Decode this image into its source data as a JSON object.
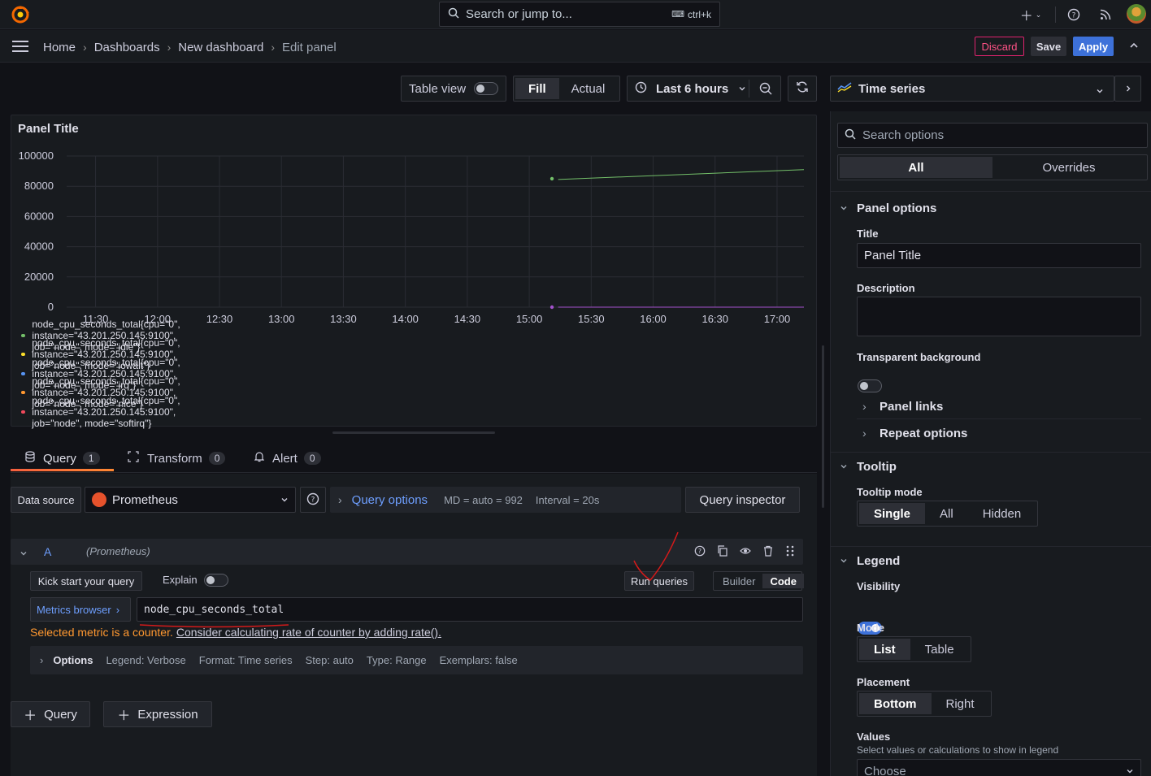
{
  "topbar": {
    "search_placeholder": "Search or jump to...",
    "search_shortcut": "ctrl+k",
    "icons": [
      "grafana-logo-icon",
      "plus-icon",
      "help-icon",
      "rss-icon",
      "user-avatar"
    ]
  },
  "breadcrumb": {
    "items": [
      "Home",
      "Dashboards",
      "New dashboard",
      "Edit panel"
    ]
  },
  "actions": {
    "discard": "Discard",
    "save": "Save",
    "apply": "Apply"
  },
  "toolbar": {
    "table_view": "Table view",
    "fill": "Fill",
    "actual": "Actual",
    "time_range": "Last 6 hours",
    "visualization": "Time series"
  },
  "panel": {
    "title": "Panel Title",
    "legend": [
      {
        "label": "node_cpu_seconds_total{cpu=\"0\", instance=\"43.201.250.145:9100\", job=\"node\", mode=\"idle\"}",
        "color": "#73bf69"
      },
      {
        "label": "node_cpu_seconds_total{cpu=\"0\", instance=\"43.201.250.145:9100\", job=\"node\", mode=\"iowait\"}",
        "color": "#fade2a"
      },
      {
        "label": "node_cpu_seconds_total{cpu=\"0\", instance=\"43.201.250.145:9100\", job=\"node\", mode=\"irq\"}",
        "color": "#5794f2"
      },
      {
        "label": "node_cpu_seconds_total{cpu=\"0\", instance=\"43.201.250.145:9100\", job=\"node\", mode=\"nice\"}",
        "color": "#ff9830"
      },
      {
        "label": "node_cpu_seconds_total{cpu=\"0\", instance=\"43.201.250.145:9100\", job=\"node\", mode=\"softirq\"}",
        "color": "#f2495c"
      }
    ]
  },
  "chart_data": {
    "type": "line",
    "x_ticks": [
      "11:30",
      "12:00",
      "12:30",
      "13:00",
      "13:30",
      "14:00",
      "14:30",
      "15:00",
      "15:30",
      "16:00",
      "16:30",
      "17:00"
    ],
    "y_ticks": [
      "100000",
      "80000",
      "60000",
      "40000",
      "20000",
      "0"
    ],
    "ylim": [
      0,
      100000
    ],
    "xlim": [
      "11:16",
      "17:13"
    ],
    "grid": true,
    "legend_placement": "bottom",
    "series": [
      {
        "color": "#73bf69",
        "x": [
          "15:11",
          "15:14",
          "17:13"
        ],
        "y": [
          85000,
          84500,
          91000
        ]
      },
      {
        "color": "#a352cc",
        "x": [
          "15:11",
          "15:14",
          "17:13"
        ],
        "y": [
          0,
          0,
          0
        ]
      }
    ]
  },
  "tabs": [
    {
      "label": "Query",
      "count": "1"
    },
    {
      "label": "Transform",
      "count": "0"
    },
    {
      "label": "Alert",
      "count": "0"
    }
  ],
  "query": {
    "data_source_label": "Data source",
    "data_source": "Prometheus",
    "query_options": "Query options",
    "md": "MD = auto = 992",
    "interval": "Interval = 20s",
    "inspector": "Query inspector",
    "ref_id": "A",
    "ref_source": "(Prometheus)",
    "kick_start": "Kick start your query",
    "explain": "Explain",
    "run_queries": "Run queries",
    "builder": "Builder",
    "code": "Code",
    "metrics_browser": "Metrics browser",
    "expression": "node_cpu_seconds_total",
    "hint_prefix": "Selected metric is a counter.",
    "hint_link": "Consider calculating rate of counter by adding rate().",
    "options_label": "Options",
    "opt_legend": "Legend: Verbose",
    "opt_format": "Format: Time series",
    "opt_step": "Step: auto",
    "opt_type": "Type: Range",
    "opt_exemplars": "Exemplars: false",
    "add_query": "Query",
    "add_expression": "Expression"
  },
  "options_pane": {
    "search_placeholder": "Search options",
    "tab_all": "All",
    "tab_overrides": "Overrides",
    "panel_options": "Panel options",
    "title_label": "Title",
    "title_value": "Panel Title",
    "description_label": "Description",
    "transparent_label": "Transparent background",
    "panel_links": "Panel links",
    "repeat_options": "Repeat options",
    "tooltip": "Tooltip",
    "tooltip_mode": "Tooltip mode",
    "tooltip_opts": [
      "Single",
      "All",
      "Hidden"
    ],
    "legend": "Legend",
    "visibility": "Visibility",
    "mode": "Mode",
    "mode_opts": [
      "List",
      "Table"
    ],
    "placement": "Placement",
    "placement_opts": [
      "Bottom",
      "Right"
    ],
    "values": "Values",
    "values_desc": "Select values or calculations to show in legend",
    "values_placeholder": "Choose"
  }
}
